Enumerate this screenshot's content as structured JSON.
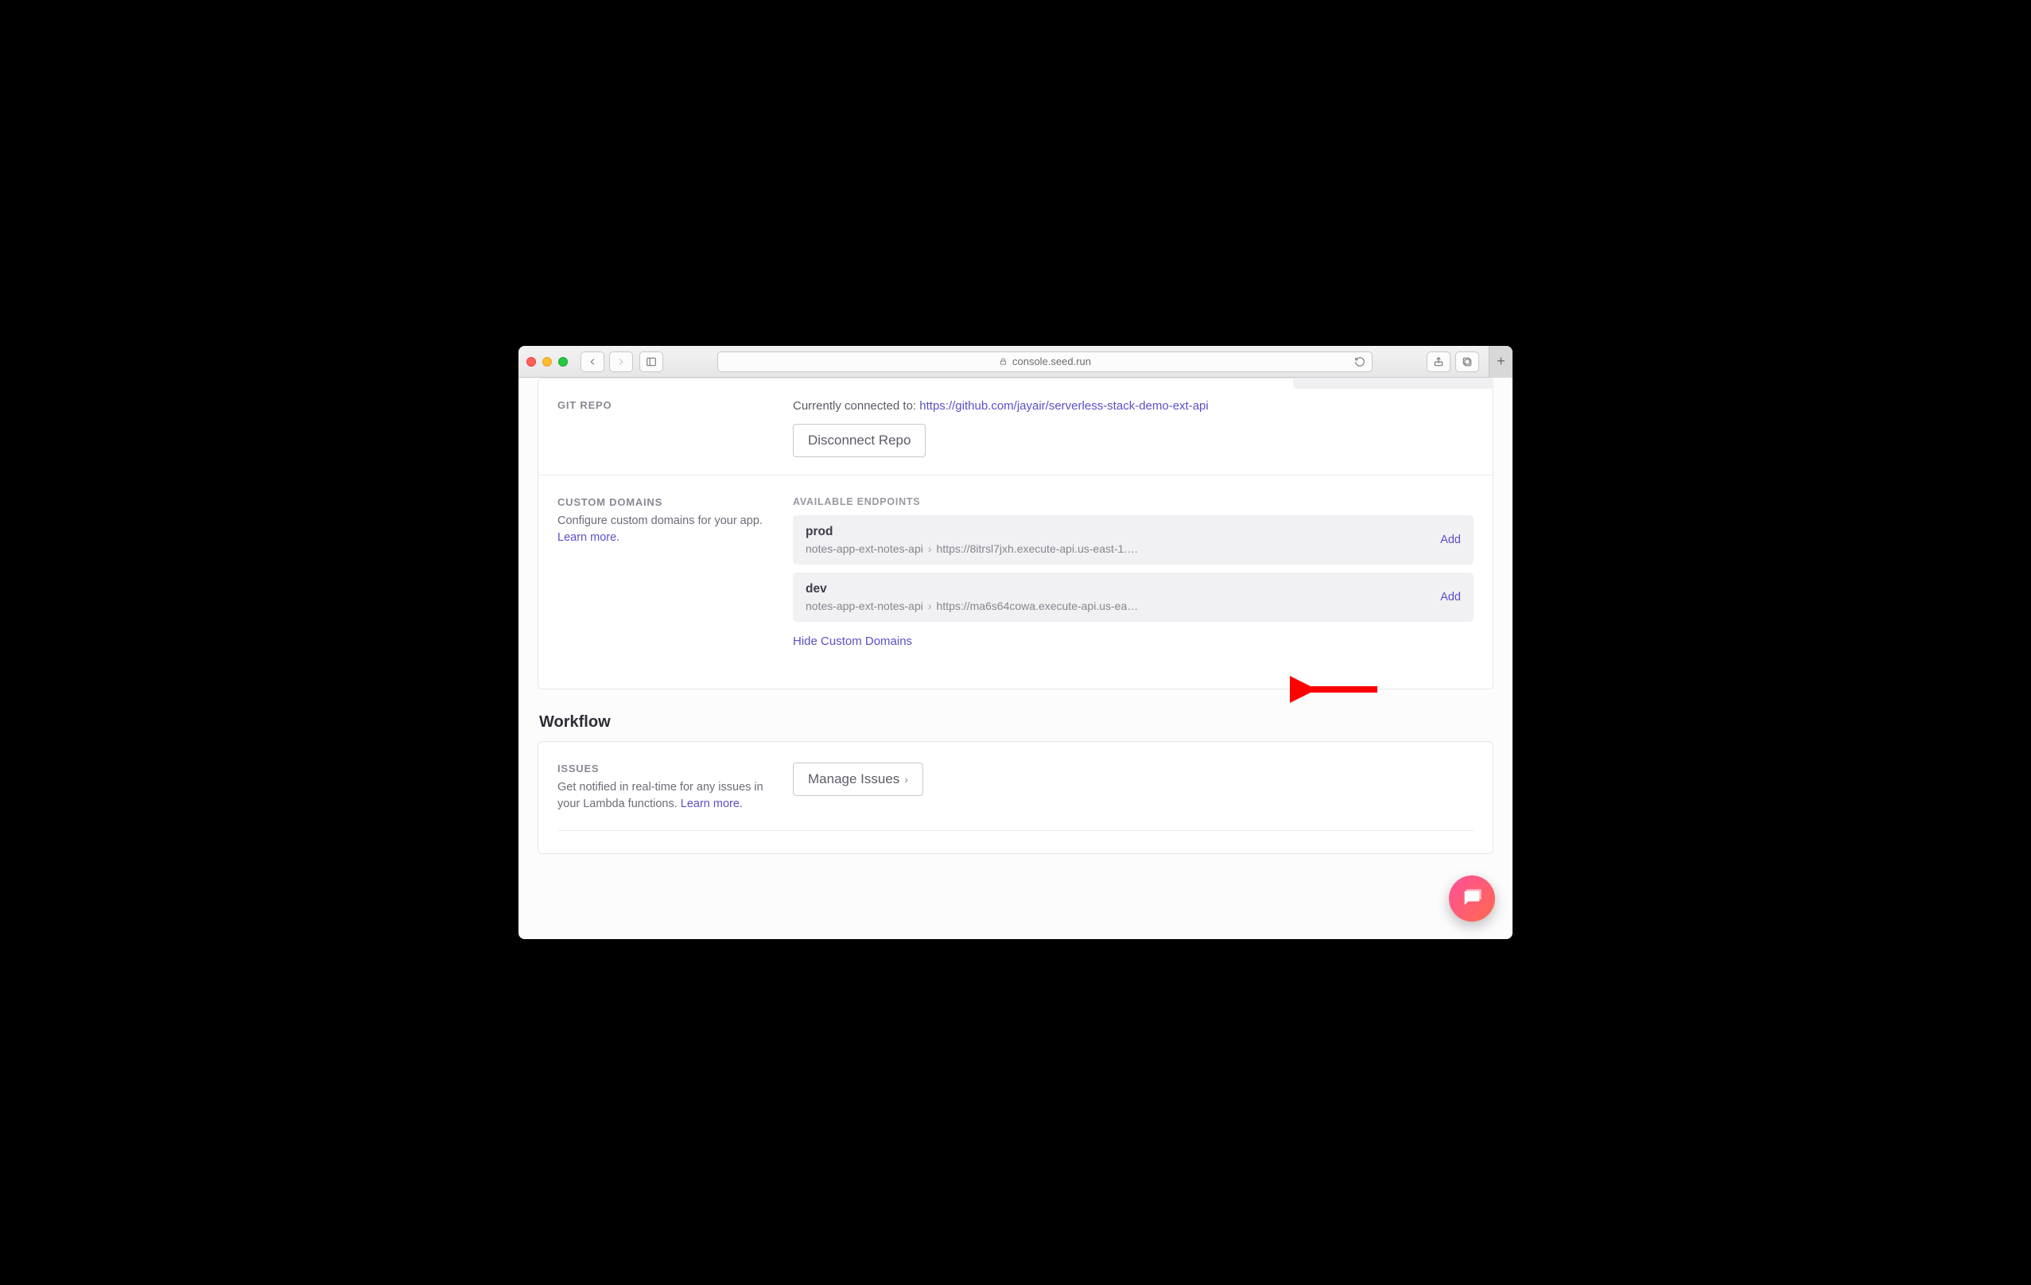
{
  "browser": {
    "url_host": "console.seed.run"
  },
  "git": {
    "title": "GIT REPO",
    "connected_prefix": "Currently connected to: ",
    "repo_url_label": "https://github.com/jayair/serverless-stack-demo-ext-api",
    "disconnect_label": "Disconnect Repo"
  },
  "domains": {
    "title": "CUSTOM DOMAINS",
    "desc_prefix": "Configure custom domains for your app. ",
    "learn_more": "Learn more.",
    "available_label": "AVAILABLE ENDPOINTS",
    "hide_label": "Hide Custom Domains",
    "add_label": "Add",
    "endpoints": [
      {
        "name": "prod",
        "stack": "notes-app-ext-notes-api",
        "url": "https://8itrsl7jxh.execute-api.us-east-1.…"
      },
      {
        "name": "dev",
        "stack": "notes-app-ext-notes-api",
        "url": "https://ma6s64cowa.execute-api.us-ea…"
      }
    ]
  },
  "workflow": {
    "heading": "Workflow",
    "issues": {
      "title": "ISSUES",
      "desc_prefix": "Get notified in real-time for any issues in your Lambda functions. ",
      "learn_more": "Learn more.",
      "manage_label": "Manage Issues"
    }
  }
}
